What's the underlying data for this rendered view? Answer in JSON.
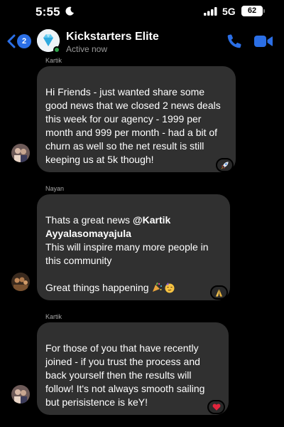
{
  "status_bar": {
    "time": "5:55",
    "network": "5G",
    "battery": "62"
  },
  "header": {
    "back_badge": "2",
    "title": "Kickstarters Elite",
    "status": "Active now"
  },
  "messages": [
    {
      "sender": "Kartik",
      "text": "Hi Friends - just wanted share some good news that we closed 2 news deals this week for our agency - 1999 per month and 999 per month - had a bit of churn as well so the net result is still keeping us at 5k though!",
      "reaction_icon": "rocket-icon"
    },
    {
      "sender": "Nayan",
      "text_prefix": "Thats a great news ",
      "mention": "@Kartik Ayyalasomayajula",
      "text_middle": "This will inspire many more people in this community",
      "text_last": "Great things happening ",
      "reaction_icon": "praying-hands-icon"
    },
    {
      "sender": "Kartik",
      "text": "For those of you that have recently joined - if you trust the process and back yourself then the results will follow! It's not always smooth sailing but perisistence is keY!",
      "reaction_icon": "heart-icon"
    }
  ],
  "colors": {
    "accent": "#2b6fe6",
    "bubble": "#303030",
    "online": "#31a24c"
  }
}
